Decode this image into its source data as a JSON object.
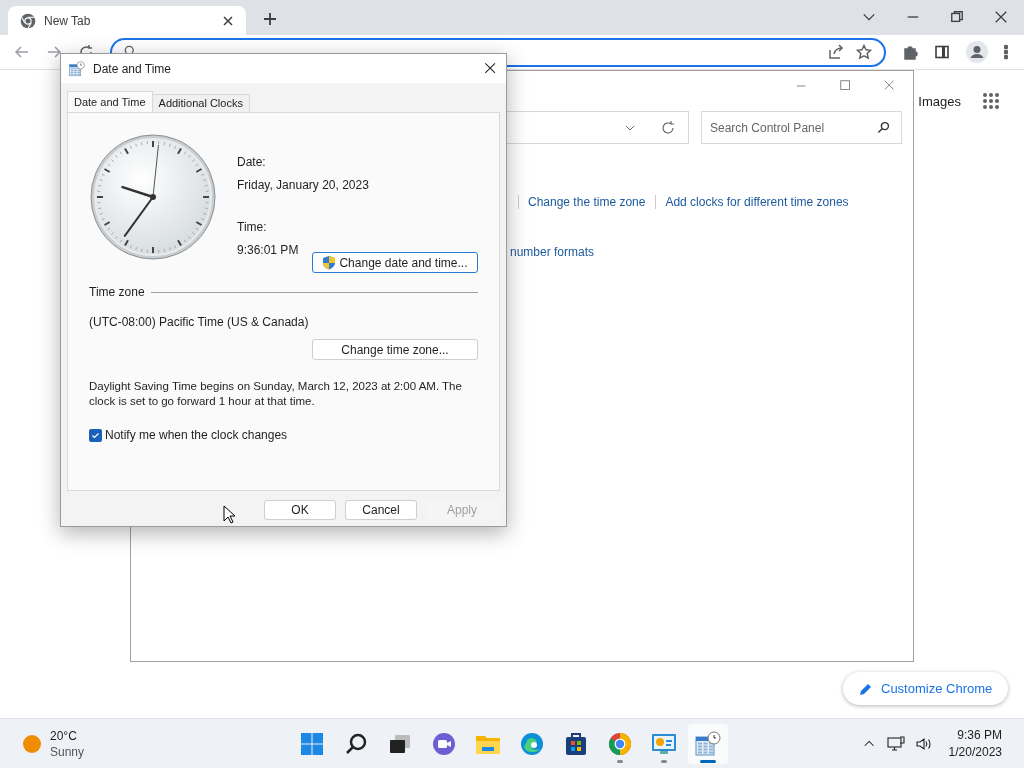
{
  "browser": {
    "tabs": [
      {
        "label": "New Tab",
        "selected": true
      }
    ],
    "page_link": "Images",
    "customize_button": "Customize Chrome"
  },
  "control_panel": {
    "search": {
      "placeholder": "Search Control Panel"
    },
    "links": [
      "Change the time zone",
      "Add clocks for different time zones"
    ],
    "second_row_link": "number formats"
  },
  "dialog": {
    "title": "Date and Time",
    "tabs": [
      {
        "label": "Date and Time",
        "selected": true
      },
      {
        "label": "Additional Clocks",
        "selected": false
      }
    ],
    "date_label": "Date:",
    "date": "Friday, January 20, 2023",
    "time_label": "Time:",
    "time": "9:36:01 PM",
    "change_datetime_button": "Change date and time...",
    "timezone_heading": "Time zone",
    "timezone": "(UTC-08:00) Pacific Time (US & Canada)",
    "change_timezone_button": "Change time zone...",
    "dst_note": "Daylight Saving Time begins on Sunday, March 12, 2023 at 2:00 AM. The clock is set to go forward 1 hour at that time.",
    "notify": {
      "label": "Notify me when the clock changes",
      "checked": true
    },
    "buttons": [
      {
        "label": "OK",
        "disabled": false
      },
      {
        "label": "Cancel",
        "disabled": false
      },
      {
        "label": "Apply",
        "disabled": true
      }
    ]
  },
  "taskbar": {
    "weather": {
      "temperature": "20°C",
      "condition": "Sunny"
    },
    "apps": [
      {
        "kind": "start",
        "running": false,
        "active": false
      },
      {
        "kind": "search",
        "running": false,
        "active": false
      },
      {
        "kind": "taskview",
        "running": false,
        "active": false
      },
      {
        "kind": "chat",
        "running": false,
        "active": false
      },
      {
        "kind": "explorer",
        "running": false,
        "active": false
      },
      {
        "kind": "edge",
        "running": false,
        "active": false
      },
      {
        "kind": "store",
        "running": false,
        "active": false
      },
      {
        "kind": "chrome",
        "running": true,
        "active": false
      },
      {
        "kind": "controlpanel",
        "running": true,
        "active": false
      },
      {
        "kind": "datetime",
        "running": true,
        "active": true
      }
    ],
    "time": "9:36 PM",
    "date": "1/20/2023"
  }
}
